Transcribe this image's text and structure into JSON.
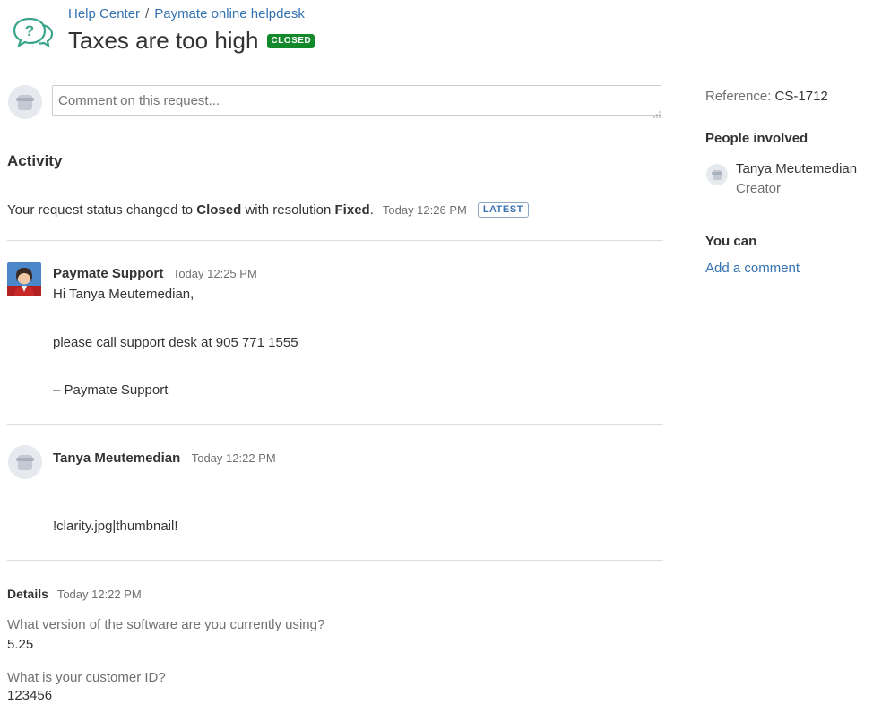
{
  "breadcrumb": {
    "items": [
      "Help Center",
      "Paymate online helpdesk"
    ],
    "separator": "/"
  },
  "request": {
    "title": "Taxes are too high",
    "status_lozenge": "CLOSED"
  },
  "comment_input": {
    "placeholder": "Comment on this request..."
  },
  "activity": {
    "heading": "Activity",
    "status_change": {
      "prefix": "Your request status changed to",
      "status": "Closed",
      "middle": "with resolution",
      "resolution": "Fixed",
      "suffix": ".",
      "time": "Today 12:26 PM",
      "badge": "LATEST"
    },
    "comments": [
      {
        "author": "Paymate Support",
        "time": "Today 12:25 PM",
        "lines": [
          "Hi Tanya Meutemedian,",
          "please call support desk at 905 771 1555",
          "– Paymate Support"
        ]
      },
      {
        "author": "Tanya Meutemedian",
        "time": "Today 12:22 PM",
        "lines": [
          "!clarity.jpg|thumbnail!"
        ]
      }
    ]
  },
  "details": {
    "heading": "Details",
    "time": "Today 12:22 PM",
    "fields": [
      {
        "question": "What version of the software are you currently using?",
        "answer": "5.25"
      },
      {
        "question": "What is your customer ID?",
        "answer": "123456"
      }
    ]
  },
  "sidebar": {
    "reference_label": "Reference:",
    "reference_value": "CS-1712",
    "people_heading": "People involved",
    "person_name": "Tanya Meutemedian",
    "person_role": "Creator",
    "you_can_heading": "You can",
    "add_comment_link": "Add a comment"
  },
  "colors": {
    "link": "#3572b0",
    "closed_lozenge": "#14892c",
    "latest_border": "#8ba6c4",
    "help_icon": "#3aa58a"
  }
}
